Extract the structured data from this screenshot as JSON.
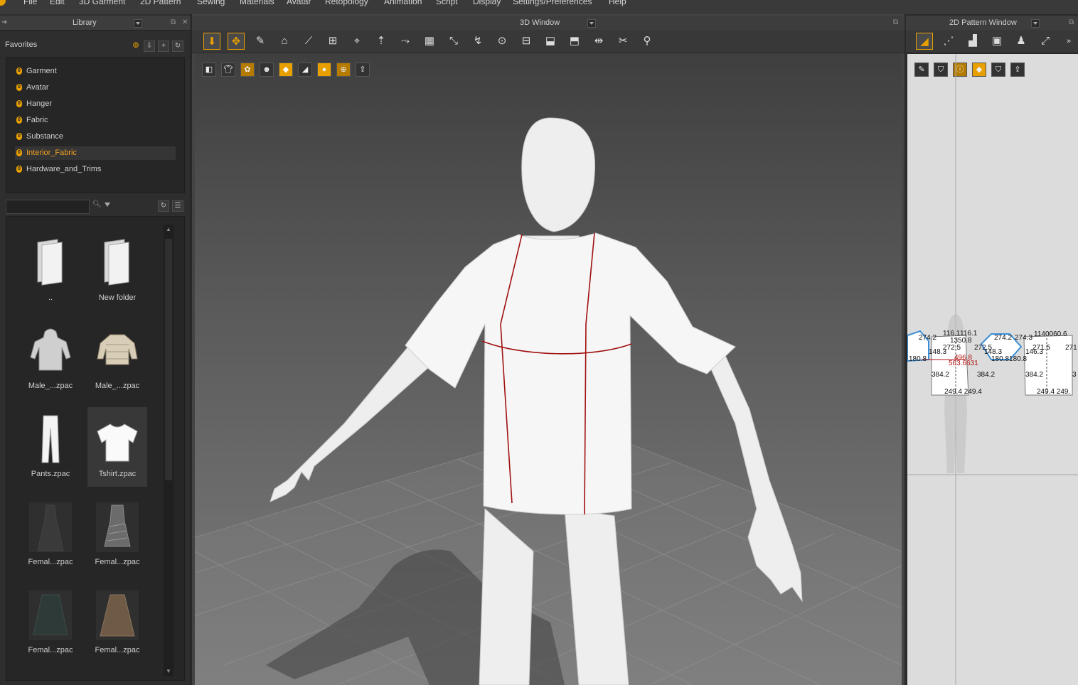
{
  "menu": [
    "File",
    "Edit",
    "3D Garment",
    "2D Pattern",
    "Sewing",
    "Materials",
    "Avatar",
    "Retopology",
    "Animation",
    "Script",
    "Display",
    "Settings/Preferences",
    "Help"
  ],
  "library": {
    "title": "Library",
    "favorites_title": "Favorites",
    "favorites": [
      "Garment",
      "Avatar",
      "Hanger",
      "Fabric",
      "Substance",
      "Interior_Fabric",
      "Hardware_and_Trims"
    ],
    "selected_favorite": "Interior_Fabric",
    "search": {
      "value": "",
      "placeholder": ""
    },
    "items": [
      {
        "caption": "..",
        "kind": "folder"
      },
      {
        "caption": "New folder",
        "kind": "folder"
      },
      {
        "caption": "Male_...zpac",
        "kind": "hoodie"
      },
      {
        "caption": "Male_...zpac",
        "kind": "puffer-jacket"
      },
      {
        "caption": "Pants.zpac",
        "kind": "pants"
      },
      {
        "caption": "Tshirt.zpac",
        "kind": "tshirt",
        "selected": true
      },
      {
        "caption": "Femal...zpac",
        "kind": "dress-dark"
      },
      {
        "caption": "Femal...zpac",
        "kind": "dress-pattern"
      },
      {
        "caption": "Femal...zpac",
        "kind": "skirt-dark"
      },
      {
        "caption": "Femal...zpac",
        "kind": "skirt-brown"
      }
    ]
  },
  "window3d": {
    "title": "3D Window",
    "tools": [
      "select-move",
      "transform",
      "edit-pattern",
      "simulate",
      "segment",
      "fold",
      "pin",
      "tack",
      "grid",
      "arrange",
      "iron",
      "punch",
      "gather",
      "measure",
      "strap",
      "button",
      "zipper",
      "cut",
      "fit"
    ],
    "active_tools": [
      0,
      1
    ],
    "view_buttons": [
      "display-mesh",
      "show-garment",
      "show-arrangement",
      "show-avatar",
      "texture-mode",
      "surface",
      "skin",
      "globe",
      "export"
    ]
  },
  "window2d": {
    "title": "2D Pattern Window",
    "tools": [
      "select",
      "transform",
      "edit-pattern",
      "cut",
      "trace",
      "shrink"
    ],
    "view_buttons": [
      "pen",
      "shirt",
      "info",
      "fabric",
      "shirt-white",
      "export"
    ],
    "measurements": [
      {
        "t": "274.2"
      },
      {
        "t": "116.1"
      },
      {
        "t": "116.1"
      },
      {
        "t": "1350.8"
      },
      {
        "t": "274.2"
      },
      {
        "t": "274.3"
      },
      {
        "t": "1140060.6"
      },
      {
        "t": "272.5"
      },
      {
        "t": "272.5"
      },
      {
        "t": "271.5"
      },
      {
        "t": "271"
      },
      {
        "t": "148.3"
      },
      {
        "t": "148.3"
      },
      {
        "t": "146.3"
      },
      {
        "t": "496.8"
      },
      {
        "t": "563.6631"
      },
      {
        "t": "180.8"
      },
      {
        "t": "180.8180.8"
      },
      {
        "t": "384.2"
      },
      {
        "t": "384.2"
      },
      {
        "t": "384.2"
      },
      {
        "t": "3"
      },
      {
        "t": "249.4 249.4"
      },
      {
        "t": "249.4 249."
      }
    ]
  },
  "colors": {
    "accent": "#e8a000",
    "seam": "#a01010",
    "pattern_outline": "#3a8fd8"
  }
}
